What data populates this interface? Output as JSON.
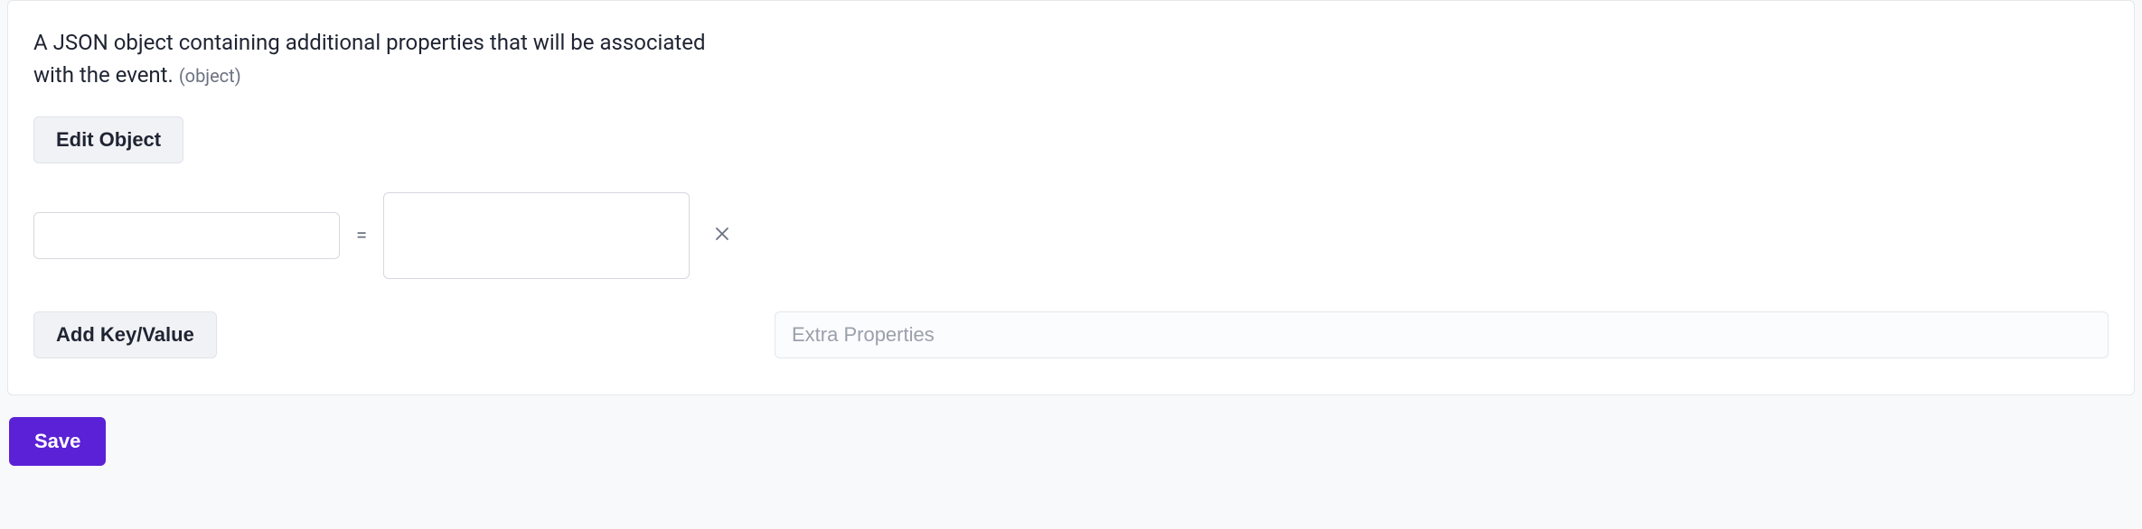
{
  "section": {
    "description_main": "A JSON object containing additional properties that will be associated with the event.",
    "type_hint": "(object)",
    "edit_object_label": "Edit Object",
    "kv_rows": [
      {
        "key": "",
        "value": "",
        "equals": "="
      }
    ],
    "add_kv_label": "Add Key/Value",
    "extra_properties_placeholder": "Extra Properties"
  },
  "footer": {
    "save_label": "Save"
  }
}
